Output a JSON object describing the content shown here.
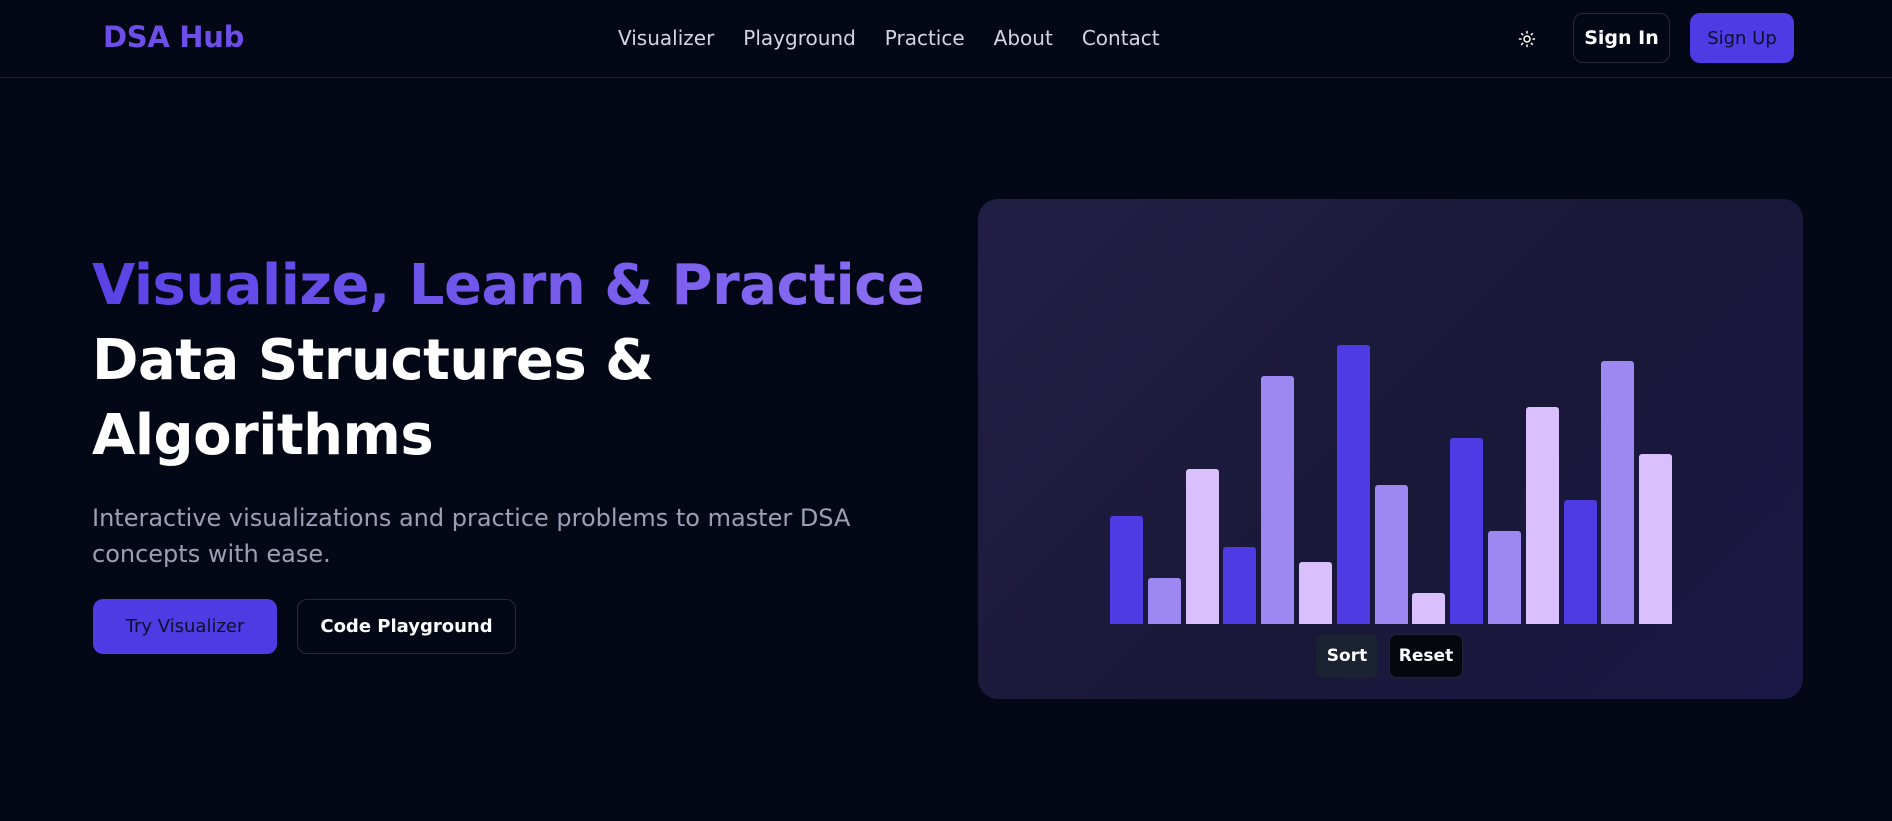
{
  "header": {
    "logo": "DSA Hub",
    "nav": [
      "Visualizer",
      "Playground",
      "Practice",
      "About",
      "Contact"
    ],
    "theme_icon": "sun-icon",
    "signin_label": "Sign In",
    "signup_label": "Sign Up"
  },
  "hero": {
    "title_accent": "Visualize, Learn & Practice",
    "title_main": "Data Structures & Algorithms",
    "subtitle": "Interactive visualizations and practice problems to master DSA concepts with ease.",
    "primary_button": "Try Visualizer",
    "secondary_button": "Code Playground"
  },
  "visualizer": {
    "bar_values": [
      35,
      15,
      50,
      25,
      80,
      20,
      90,
      45,
      10,
      60,
      30,
      70,
      40,
      85,
      55
    ],
    "max_value": 100,
    "bar_colors": [
      "#4f3be3",
      "#9d88f2",
      "#d9bffb"
    ],
    "sort_label": "Sort",
    "reset_label": "Reset"
  }
}
